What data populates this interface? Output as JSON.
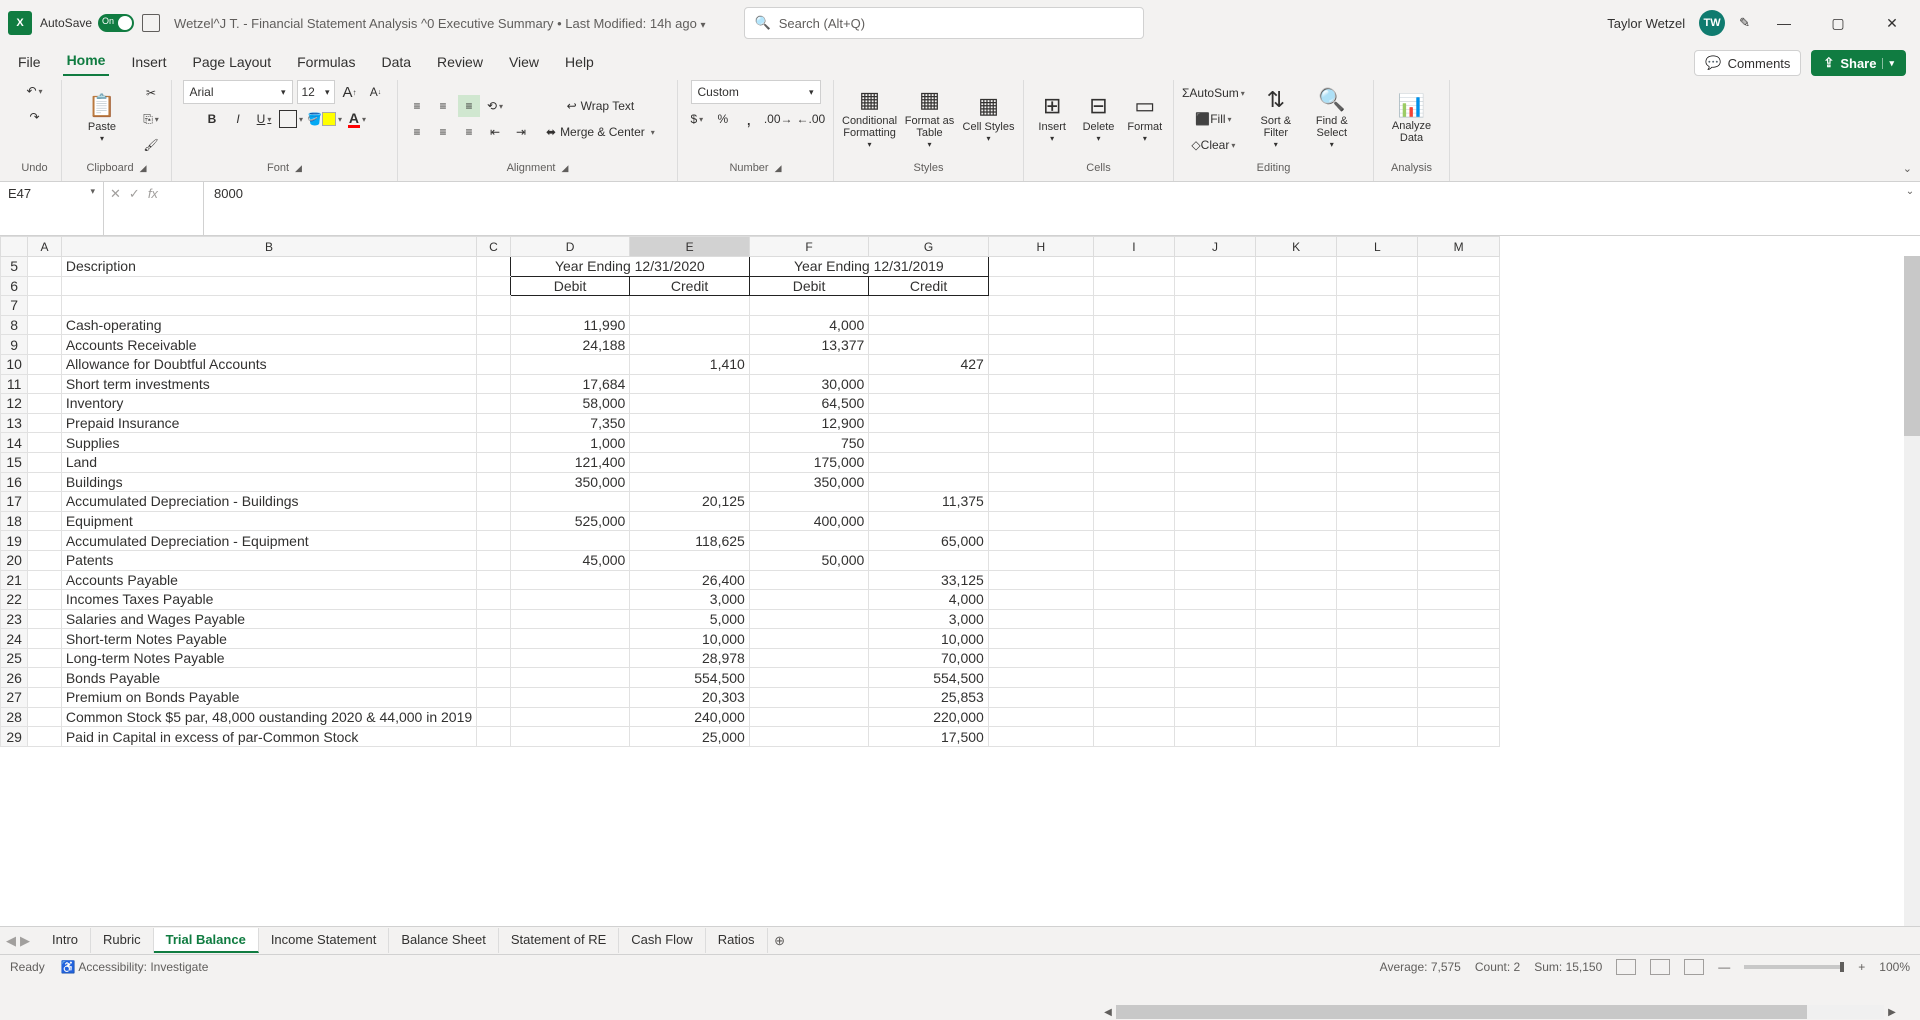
{
  "title_bar": {
    "app": "X",
    "autosave_label": "AutoSave",
    "doc_title": "Wetzel^J T. - Financial Statement Analysis ^0 Executive Summary • Last Modified: 14h ago",
    "search_placeholder": "Search (Alt+Q)",
    "user_name": "Taylor Wetzel",
    "user_initials": "TW"
  },
  "tabs": {
    "items": [
      "File",
      "Home",
      "Insert",
      "Page Layout",
      "Formulas",
      "Data",
      "Review",
      "View",
      "Help"
    ],
    "active": "Home",
    "comments": "Comments",
    "share": "Share"
  },
  "ribbon": {
    "undo": "Undo",
    "clipboard": "Clipboard",
    "paste": "Paste",
    "font_group": "Font",
    "font_name": "Arial",
    "font_size": "12",
    "alignment": "Alignment",
    "wrap_text": "Wrap Text",
    "merge_center": "Merge & Center",
    "number": "Number",
    "number_format": "Custom",
    "styles": "Styles",
    "cond_fmt": "Conditional Formatting",
    "fmt_table": "Format as Table",
    "cell_styles": "Cell Styles",
    "cells": "Cells",
    "insert": "Insert",
    "delete": "Delete",
    "format": "Format",
    "editing": "Editing",
    "autosum": "AutoSum",
    "fill": "Fill",
    "clear": "Clear",
    "sort_filter": "Sort & Filter",
    "find_select": "Find & Select",
    "analysis": "Analysis",
    "analyze_data": "Analyze Data"
  },
  "fbar": {
    "name_box": "E47",
    "formula": "8000"
  },
  "columns": [
    "A",
    "B",
    "C",
    "D",
    "E",
    "F",
    "G",
    "H",
    "I",
    "J",
    "K",
    "L",
    "M"
  ],
  "rows": [
    {
      "n": 5,
      "B": "Description",
      "D_merge": "Year Ending 12/31/2020",
      "F_merge": "Year Ending 12/31/2019"
    },
    {
      "n": 6,
      "D": "Debit",
      "E": "Credit",
      "F": "Debit",
      "G": "Credit"
    },
    {
      "n": 7
    },
    {
      "n": 8,
      "B": "Cash-operating",
      "D": "11,990",
      "F": "4,000"
    },
    {
      "n": 9,
      "B": "Accounts Receivable",
      "D": "24,188",
      "F": "13,377"
    },
    {
      "n": 10,
      "B": "Allowance for Doubtful Accounts",
      "E": "1,410",
      "G": "427"
    },
    {
      "n": 11,
      "B": "Short term investments",
      "D": "17,684",
      "F": "30,000"
    },
    {
      "n": 12,
      "B": "Inventory",
      "D": "58,000",
      "F": "64,500"
    },
    {
      "n": 13,
      "B": "Prepaid Insurance",
      "D": "7,350",
      "F": "12,900"
    },
    {
      "n": 14,
      "B": "Supplies",
      "D": "1,000",
      "F": "750"
    },
    {
      "n": 15,
      "B": "Land",
      "D": "121,400",
      "F": "175,000"
    },
    {
      "n": 16,
      "B": "Buildings",
      "D": "350,000",
      "F": "350,000"
    },
    {
      "n": 17,
      "B": "Accumulated Depreciation - Buildings",
      "E": "20,125",
      "G": "11,375"
    },
    {
      "n": 18,
      "B": "Equipment",
      "D": "525,000",
      "F": "400,000"
    },
    {
      "n": 19,
      "B": "Accumulated Depreciation - Equipment",
      "E": "118,625",
      "G": "65,000"
    },
    {
      "n": 20,
      "B": "Patents",
      "D": "45,000",
      "F": "50,000"
    },
    {
      "n": 21,
      "B": "Accounts Payable",
      "E": "26,400",
      "G": "33,125"
    },
    {
      "n": 22,
      "B": "Incomes Taxes Payable",
      "E": "3,000",
      "G": "4,000"
    },
    {
      "n": 23,
      "B": "Salaries and Wages Payable",
      "E": "5,000",
      "G": "3,000"
    },
    {
      "n": 24,
      "B": "Short-term Notes Payable",
      "E": "10,000",
      "G": "10,000"
    },
    {
      "n": 25,
      "B": "Long-term Notes Payable",
      "E": "28,978",
      "G": "70,000"
    },
    {
      "n": 26,
      "B": "Bonds Payable",
      "E": "554,500",
      "G": "554,500"
    },
    {
      "n": 27,
      "B": "Premium on Bonds Payable",
      "E": "20,303",
      "G": "25,853"
    },
    {
      "n": 28,
      "B": "Common Stock $5 par, 48,000 oustanding 2020 & 44,000 in 2019",
      "E": "240,000",
      "G": "220,000"
    },
    {
      "n": 29,
      "B": "Paid in Capital in excess of par-Common Stock",
      "E": "25,000",
      "G": "17,500"
    }
  ],
  "sheet_tabs": [
    "Intro",
    "Rubric",
    "Trial Balance",
    "Income Statement",
    "Balance Sheet",
    "Statement of RE",
    "Cash Flow",
    "Ratios"
  ],
  "active_sheet": "Trial Balance",
  "status": {
    "ready": "Ready",
    "accessibility": "Accessibility: Investigate",
    "average": "Average: 7,575",
    "count": "Count: 2",
    "sum": "Sum: 15,150",
    "zoom": "100%"
  }
}
